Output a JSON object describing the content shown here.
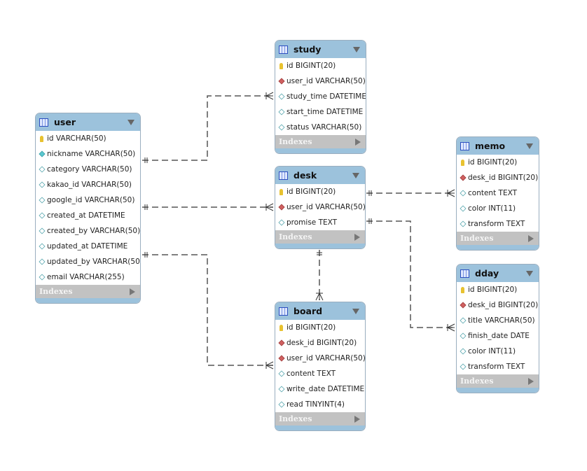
{
  "indexes_label": "Indexes",
  "colors": {
    "header": "#9cc2dc",
    "line": "#555555",
    "pk": "#e8c230",
    "fk": "#d06060"
  },
  "tables": [
    {
      "id": "user",
      "name": "user",
      "columns": [
        {
          "text": "id VARCHAR(50)",
          "kind": "pk"
        },
        {
          "text": "nickname VARCHAR(50)",
          "kind": "nn"
        },
        {
          "text": "category VARCHAR(50)",
          "kind": "col"
        },
        {
          "text": "kakao_id VARCHAR(50)",
          "kind": "col"
        },
        {
          "text": "google_id VARCHAR(50)",
          "kind": "col"
        },
        {
          "text": "created_at DATETIME",
          "kind": "col"
        },
        {
          "text": "created_by VARCHAR(50)",
          "kind": "col"
        },
        {
          "text": "updated_at DATETIME",
          "kind": "col"
        },
        {
          "text": "updated_by VARCHAR(50)",
          "kind": "col"
        },
        {
          "text": "email VARCHAR(255)",
          "kind": "col"
        }
      ]
    },
    {
      "id": "study",
      "name": "study",
      "columns": [
        {
          "text": "id BIGINT(20)",
          "kind": "pk"
        },
        {
          "text": "user_id VARCHAR(50)",
          "kind": "fk"
        },
        {
          "text": "study_time DATETIME",
          "kind": "col"
        },
        {
          "text": "start_time DATETIME",
          "kind": "col"
        },
        {
          "text": "status VARCHAR(50)",
          "kind": "col"
        }
      ]
    },
    {
      "id": "desk",
      "name": "desk",
      "columns": [
        {
          "text": "id BIGINT(20)",
          "kind": "pk"
        },
        {
          "text": "user_id VARCHAR(50)",
          "kind": "fk"
        },
        {
          "text": "promise TEXT",
          "kind": "col"
        }
      ]
    },
    {
      "id": "board",
      "name": "board",
      "columns": [
        {
          "text": "id BIGINT(20)",
          "kind": "pk"
        },
        {
          "text": "desk_id BIGINT(20)",
          "kind": "fk"
        },
        {
          "text": "user_id VARCHAR(50)",
          "kind": "fk"
        },
        {
          "text": "content TEXT",
          "kind": "col"
        },
        {
          "text": "write_date DATETIME",
          "kind": "col"
        },
        {
          "text": "read TINYINT(4)",
          "kind": "col"
        }
      ]
    },
    {
      "id": "memo",
      "name": "memo",
      "columns": [
        {
          "text": "id BIGINT(20)",
          "kind": "pk"
        },
        {
          "text": "desk_id BIGINT(20)",
          "kind": "fk"
        },
        {
          "text": "content TEXT",
          "kind": "col"
        },
        {
          "text": "color INT(11)",
          "kind": "col"
        },
        {
          "text": "transform TEXT",
          "kind": "col"
        }
      ]
    },
    {
      "id": "dday",
      "name": "dday",
      "columns": [
        {
          "text": "id BIGINT(20)",
          "kind": "pk"
        },
        {
          "text": "desk_id BIGINT(20)",
          "kind": "fk"
        },
        {
          "text": "title VARCHAR(50)",
          "kind": "col"
        },
        {
          "text": "finish_date DATE",
          "kind": "col"
        },
        {
          "text": "color INT(11)",
          "kind": "col"
        },
        {
          "text": "transform TEXT",
          "kind": "col"
        }
      ]
    }
  ],
  "relationships": [
    {
      "from": "user",
      "to": "study",
      "type": "one-to-many"
    },
    {
      "from": "user",
      "to": "desk",
      "type": "one-to-many"
    },
    {
      "from": "user",
      "to": "board",
      "type": "one-to-many"
    },
    {
      "from": "desk",
      "to": "memo",
      "type": "one-to-many"
    },
    {
      "from": "desk",
      "to": "dday",
      "type": "one-to-many"
    },
    {
      "from": "desk",
      "to": "board",
      "type": "one-to-many"
    }
  ]
}
